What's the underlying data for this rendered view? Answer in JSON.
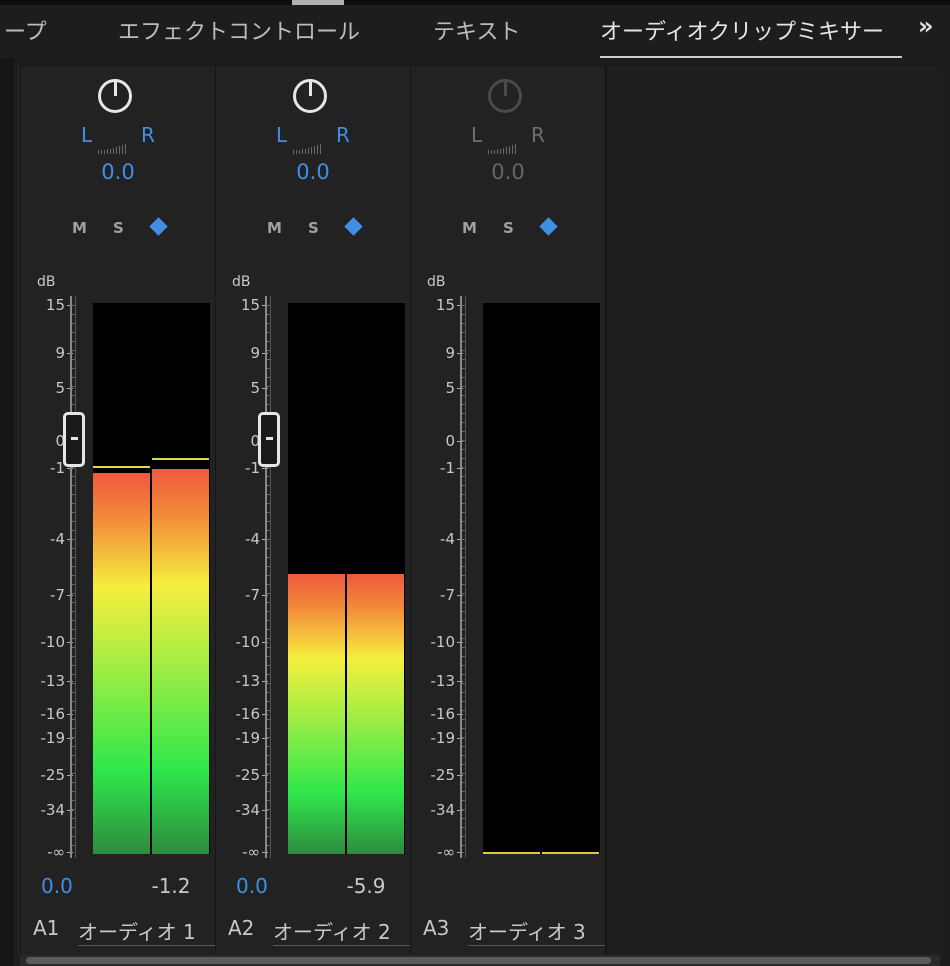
{
  "tabs": [
    {
      "label": "ープ"
    },
    {
      "label": "エフェクトコントロール"
    },
    {
      "label": "テキスト"
    },
    {
      "label": "オーディオクリップミキサー"
    }
  ],
  "overflow_label": "»",
  "db_label": "dB",
  "scale_labels": [
    "15",
    "9",
    "5",
    "0",
    "-1",
    "-4",
    "-7",
    "-10",
    "-13",
    "-16",
    "-19",
    "-25",
    "-34",
    "-∞"
  ],
  "channels": [
    {
      "id": "A1",
      "name": "オーディオ 1",
      "pan_L": "L",
      "pan_R": "R",
      "pan_value": "0.0",
      "mute": "M",
      "solo": "S",
      "volume": "0.0",
      "peak": "-1.2",
      "level_db": -1.2,
      "active": true
    },
    {
      "id": "A2",
      "name": "オーディオ 2",
      "pan_L": "L",
      "pan_R": "R",
      "pan_value": "0.0",
      "mute": "M",
      "solo": "S",
      "volume": "0.0",
      "peak": "-5.9",
      "level_db": -5.9,
      "active": true
    },
    {
      "id": "A3",
      "name": "オーディオ 3",
      "pan_L": "L",
      "pan_R": "R",
      "pan_value": "0.0",
      "mute": "M",
      "solo": "S",
      "volume": "",
      "peak": "",
      "level_db": null,
      "active": false
    }
  ],
  "colors": {
    "accent": "#3f8fe6",
    "meter_peak": "#e2d54a"
  }
}
